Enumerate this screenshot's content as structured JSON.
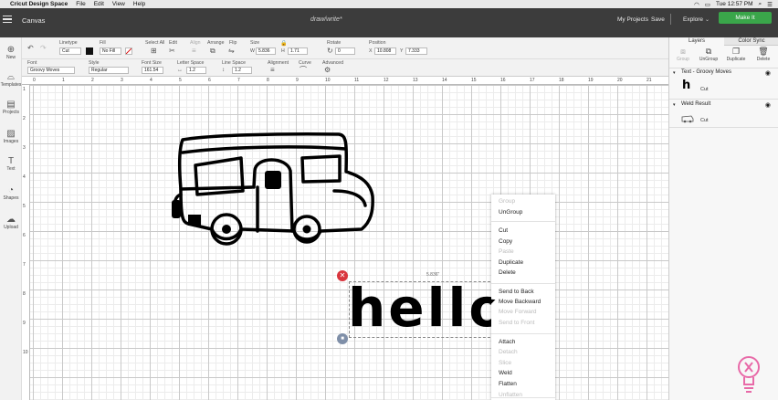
{
  "macbar": {
    "app": "Cricut Design Space",
    "menus": [
      "File",
      "Edit",
      "View",
      "Help"
    ],
    "time": "Tue 12:57 PM"
  },
  "topbar": {
    "canvas": "Canvas",
    "doc": "draw/write*",
    "my_projects": "My Projects",
    "save": "Save",
    "explore": "Explore",
    "make_it": "Make It",
    "accent": "#3aa64a"
  },
  "toolbar": {
    "linetype_label": "Linetype",
    "linetype": "Cut",
    "fill_label": "Fill",
    "fill": "No Fill",
    "select_all": "Select All",
    "edit": "Edit",
    "align": "Align",
    "arrange": "Arrange",
    "flip": "Flip",
    "size_label": "Size",
    "w_label": "W",
    "w": "5.836",
    "h_label": "H",
    "h": "1.71",
    "rotate_label": "Rotate",
    "rotate": "0",
    "position_label": "Position",
    "x_label": "X",
    "x": "10.808",
    "y_label": "Y",
    "y": "7.333",
    "font_label": "Font",
    "font": "Groovy Moves",
    "style_label": "Style",
    "style": "Regular",
    "font_size_label": "Font Size",
    "font_size": "161.54",
    "letter_space_label": "Letter Space",
    "letter_space": "1.2",
    "line_space_label": "Line Space",
    "line_space": "1.2",
    "alignment_label": "Alignment",
    "curve_label": "Curve",
    "advanced_label": "Advanced"
  },
  "leftnav": [
    "New",
    "Templates",
    "Projects",
    "Images",
    "Text",
    "Shapes",
    "Upload"
  ],
  "ruler": {
    "x": [
      "0",
      "1",
      "2",
      "3",
      "4",
      "5",
      "6",
      "7",
      "8",
      "9",
      "10",
      "11",
      "12",
      "13",
      "14",
      "15",
      "16",
      "17",
      "18",
      "19",
      "20",
      "21"
    ],
    "y": [
      "1",
      "2",
      "3",
      "4",
      "5",
      "6",
      "7",
      "8",
      "9",
      "10"
    ]
  },
  "canvas": {
    "text": "hello",
    "dimension": "5.836\""
  },
  "context_menu": {
    "items": [
      {
        "label": "Group",
        "enabled": false
      },
      {
        "label": "UnGroup",
        "enabled": true
      },
      {
        "label": "Cut",
        "enabled": true
      },
      {
        "label": "Copy",
        "enabled": true
      },
      {
        "label": "Paste",
        "enabled": false
      },
      {
        "label": "Duplicate",
        "enabled": true
      },
      {
        "label": "Delete",
        "enabled": true
      },
      {
        "label": "Send to Back",
        "enabled": true
      },
      {
        "label": "Move Backward",
        "enabled": true
      },
      {
        "label": "Move Forward",
        "enabled": false
      },
      {
        "label": "Send to Front",
        "enabled": false
      },
      {
        "label": "Attach",
        "enabled": true
      },
      {
        "label": "Detach",
        "enabled": false
      },
      {
        "label": "Slice",
        "enabled": false
      },
      {
        "label": "Weld",
        "enabled": true
      },
      {
        "label": "Flatten",
        "enabled": true
      },
      {
        "label": "Unflatten",
        "enabled": false
      }
    ]
  },
  "layers": {
    "tab_layers": "Layers",
    "tab_color_sync": "Color Sync",
    "actions": [
      "Group",
      "UnGroup",
      "Duplicate",
      "Delete"
    ],
    "groups": [
      {
        "name": "Text - Groovy Moves",
        "item": "Cut"
      },
      {
        "name": "Weld Result",
        "item": "Cut"
      }
    ]
  }
}
